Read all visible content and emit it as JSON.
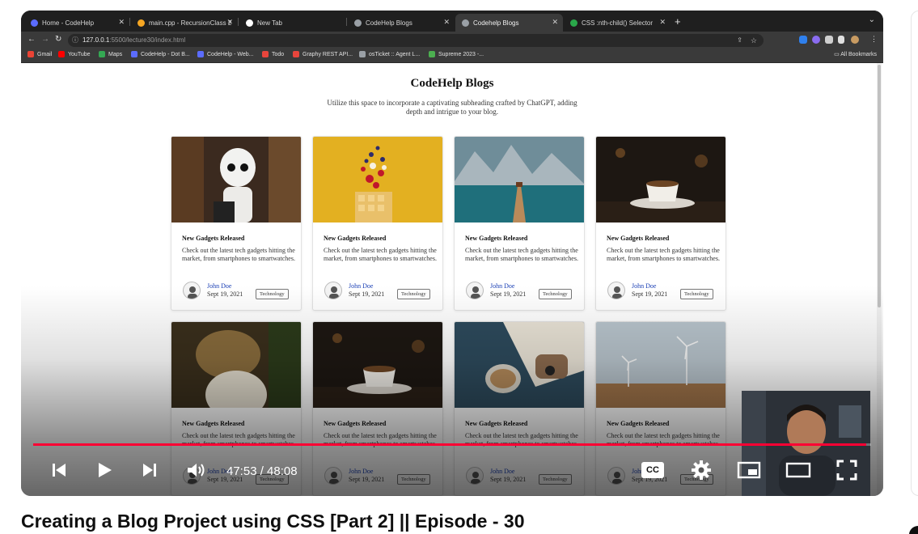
{
  "browser": {
    "tabs": [
      {
        "title": "Home - CodeHelp",
        "color": "#5b6cff"
      },
      {
        "title": "main.cpp - RecursionClass 2",
        "color": "#f5a623"
      },
      {
        "title": "New Tab",
        "color": "#ffffff"
      },
      {
        "title": "CodeHelp Blogs",
        "color": "#9aa0a6"
      },
      {
        "title": "Codehelp Blogs",
        "color": "#9aa0a6"
      },
      {
        "title": "CSS :nth-child() Selector",
        "color": "#2aa84a"
      }
    ],
    "active_tab_index": 4,
    "url_host": "127.0.0.1",
    "url_path": ":5500/lecture30/index.html",
    "bookmarks": [
      {
        "label": "Gmail",
        "color": "#ea4335"
      },
      {
        "label": "YouTube",
        "color": "#ff0000"
      },
      {
        "label": "Maps",
        "color": "#34a853"
      },
      {
        "label": "CodeHelp - Dot B...",
        "color": "#5b6cff"
      },
      {
        "label": "CodeHelp - Web...",
        "color": "#5b6cff"
      },
      {
        "label": "Todo",
        "color": "#e8453c"
      },
      {
        "label": "Graphy REST API...",
        "color": "#e8453c"
      },
      {
        "label": "osTicket :: Agent L...",
        "color": "#9aa0a6"
      },
      {
        "label": "Supreme 2023 -...",
        "color": "#4caf50"
      }
    ],
    "all_bookmarks": "All Bookmarks"
  },
  "page": {
    "title": "CodeHelp Blogs",
    "subtitle": "Utilize this space to incorporate a captivating subheading crafted by ChatGPT, adding depth and intrigue to your blog."
  },
  "cards": [
    {
      "image": "robot",
      "title": "New Gadgets Released",
      "description": "Check out the latest tech gadgets hitting the market, from smartphones to smartwatches.",
      "author": "John Doe",
      "date": "Sept 19, 2021",
      "tag": "Technology"
    },
    {
      "image": "waffle",
      "title": "New Gadgets Released",
      "description": "Check out the latest tech gadgets hitting the market, from smartphones to smartwatches.",
      "author": "John Doe",
      "date": "Sept 19, 2021",
      "tag": "Technology"
    },
    {
      "image": "lake-pier",
      "title": "New Gadgets Released",
      "description": "Check out the latest tech gadgets hitting the market, from smartphones to smartwatches.",
      "author": "John Doe",
      "date": "Sept 19, 2021",
      "tag": "Technology"
    },
    {
      "image": "coffee-cup",
      "title": "New Gadgets Released",
      "description": "Check out the latest tech gadgets hitting the market, from smartphones to smartwatches.",
      "author": "John Doe",
      "date": "Sept 19, 2021",
      "tag": "Technology"
    },
    {
      "image": "woman-motion",
      "title": "New Gadgets Released",
      "description": "Check out the latest tech gadgets hitting the market, from smartphones to smartwatches.",
      "author": "John Doe",
      "date": "Sept 19, 2021",
      "tag": "Technology"
    },
    {
      "image": "coffee-cup",
      "title": "New Gadgets Released",
      "description": "Check out the latest tech gadgets hitting the market, from smartphones to smartwatches.",
      "author": "John Doe",
      "date": "Sept 19, 2021",
      "tag": "Technology"
    },
    {
      "image": "breakfast-table",
      "title": "New Gadgets Released",
      "description": "Check out the latest tech gadgets hitting the market, from smartphones to smartwatches.",
      "author": "John Doe",
      "date": "Sept 19, 2021",
      "tag": "Technology"
    },
    {
      "image": "wind-turbines",
      "title": "New Gadgets Released",
      "description": "Check out the latest tech gadgets hitting the market, from smartphones to smartwatches.",
      "author": "John Doe",
      "date": "Sept 19, 2021",
      "tag": "Technology"
    }
  ],
  "player": {
    "current_time": "47:53",
    "duration": "48:08",
    "time_display": "47:53 / 48:08",
    "progress_fraction": 0.9945,
    "accent_color": "#ff0033",
    "controls": [
      "previous-icon",
      "play-icon",
      "next-icon",
      "volume-icon",
      "captions-icon",
      "settings-icon",
      "miniplayer-icon",
      "theater-icon",
      "fullscreen-icon"
    ],
    "captions_label": "CC"
  },
  "video": {
    "title": "Creating a Blog Project using CSS [Part 2] || Episode - 30"
  }
}
